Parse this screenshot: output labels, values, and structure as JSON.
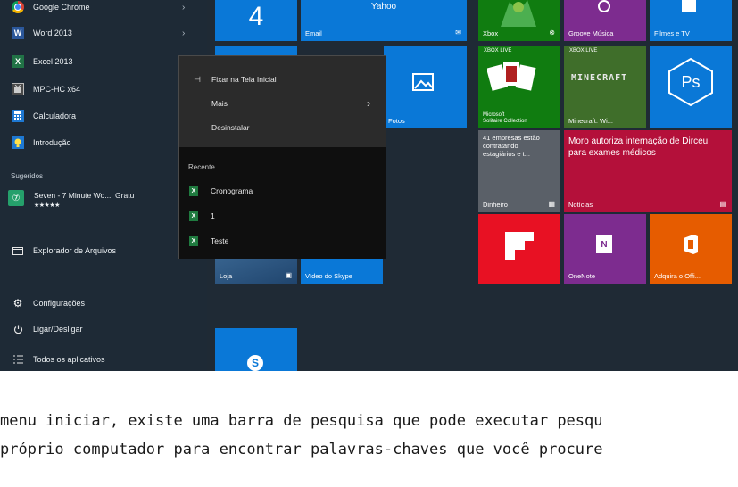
{
  "left_menu": {
    "items": [
      {
        "label": "Google Chrome",
        "icon": "chrome-icon",
        "has_arrow": true
      },
      {
        "label": "Word 2013",
        "icon": "word-icon",
        "has_arrow": true
      },
      {
        "label": "Excel 2013",
        "icon": "excel-icon",
        "has_arrow": true
      },
      {
        "label": "MPC-HC x64",
        "icon": "mpc-icon",
        "has_arrow": false
      },
      {
        "label": "Calculadora",
        "icon": "calculator-icon",
        "has_arrow": false
      },
      {
        "label": "Introdução",
        "icon": "lightbulb-icon",
        "has_arrow": false
      }
    ],
    "suggested_label": "Sugeridos",
    "suggested": {
      "title": "Seven - 7 Minute Wo...",
      "price": "Gratu",
      "stars": "★★★★★"
    },
    "bottom_items": [
      {
        "label": "Explorador de Arquivos",
        "icon": "folder-icon",
        "has_arrow": true
      },
      {
        "label": "Configurações",
        "icon": "gear-icon",
        "has_arrow": false
      },
      {
        "label": "Ligar/Desligar",
        "icon": "power-icon",
        "has_arrow": false
      },
      {
        "label": "Todos os aplicativos",
        "icon": "list-icon",
        "has_arrow": false
      }
    ],
    "word_icon_text": "W",
    "excel_icon_text": "X"
  },
  "tiles": {
    "calendar_number": "4",
    "yahoo": "Yahoo",
    "email": "Email",
    "xbox": "Xbox",
    "groove": "Groove Música",
    "filmes": "Filmes e TV",
    "xbox_live_1": "XBOX LIVE",
    "xbox_live_2": "XBOX LIVE",
    "solitaire": "Microsoft\nSolitaire Collection",
    "minecraft": "Minecraft: Wi...",
    "minecraft_logo": "MINECRAFT",
    "ps": "Ps",
    "fotos": "Fotos",
    "dinheiro_text": "41 empresas estão contratando estagiários e t...",
    "dinheiro": "Dinheiro",
    "news_text": "Moro autoriza internação de Dirceu para exames médicos",
    "noticias": "Notícias",
    "loja": "Loja",
    "skype_video": "Vídeo do Skype",
    "onenote": "OneNote",
    "office": "Adquira o Offi...",
    "skype_letter": "S"
  },
  "context_menu": {
    "pin": "Fixar na Tela Inicial",
    "more": "Mais",
    "uninstall": "Desinstalar",
    "recent_label": "Recente",
    "recent": [
      "Cronograma",
      "1",
      "Teste"
    ]
  },
  "caption": {
    "line1": "menu iniciar, existe uma barra de pesquisa que pode executar pesqu",
    "line2": "próprio computador para encontrar palavras-chaves que você procure"
  },
  "colors": {
    "tile_blue": "#0a78d7",
    "tile_green": "#107c10",
    "tile_red": "#e81123",
    "tile_purple": "#7d2c8f",
    "tile_orange": "#e65c00",
    "tile_magenta": "#b4103a"
  }
}
